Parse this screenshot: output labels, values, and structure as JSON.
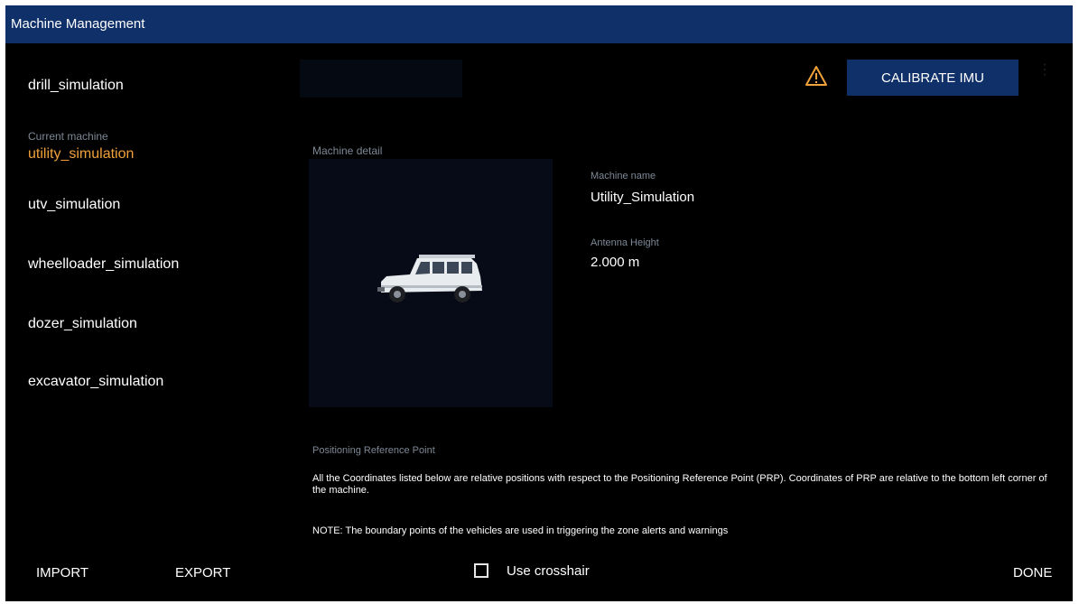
{
  "window": {
    "title": "Machine Management"
  },
  "sidebar": {
    "machines": [
      {
        "name": "drill_simulation"
      },
      {
        "name": "utv_simulation"
      },
      {
        "name": "wheelloader_simulation"
      },
      {
        "name": "dozer_simulation"
      },
      {
        "name": "excavator_simulation"
      }
    ],
    "current": {
      "label": "Current machine",
      "name": "utility_simulation"
    }
  },
  "toolbar": {
    "calibrate_label": "CALIBRATE IMU",
    "warning_icon": "warning-triangle-icon",
    "more_icon": "more-vertical-icon"
  },
  "detail": {
    "section_label": "Machine detail",
    "machine_name_label": "Machine name",
    "machine_name_value": "Utility_Simulation",
    "antenna_label": "Antenna Height",
    "antenna_value": "2.000  m"
  },
  "prp": {
    "label": "Positioning Reference Point",
    "description": "All the Coordinates listed below are relative positions with respect to the Positioning Reference Point (PRP). Coordinates of PRP are relative to the bottom left corner of the machine.",
    "note": "NOTE: The boundary points of the vehicles are used in triggering the zone alerts and warnings"
  },
  "footer": {
    "import_label": "IMPORT",
    "export_label": "EXPORT",
    "crosshair_label": "Use crosshair",
    "crosshair_checked": false,
    "done_label": "DONE"
  },
  "colors": {
    "title_bar": "#10306a",
    "background": "#000000",
    "accent_current": "#f0a23a",
    "warning": "#f0a23a",
    "button_bg": "#10306a"
  }
}
